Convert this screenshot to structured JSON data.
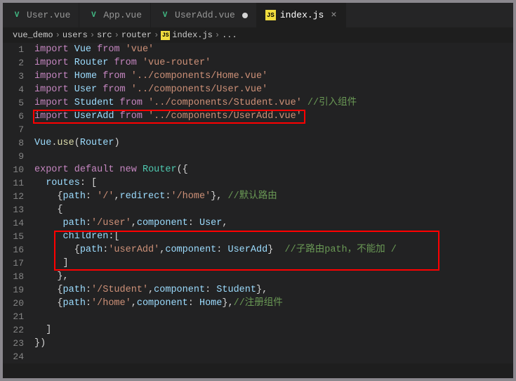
{
  "tabs": [
    {
      "icon": "V",
      "label": "User.vue",
      "modified": false,
      "close": false
    },
    {
      "icon": "V",
      "label": "App.vue",
      "modified": false,
      "close": false
    },
    {
      "icon": "V",
      "label": "UserAdd.vue",
      "modified": true,
      "close": false
    },
    {
      "icon": "JS",
      "label": "index.js",
      "modified": false,
      "close": true,
      "active": true
    }
  ],
  "breadcrumb": [
    "vue_demo",
    "users",
    "src",
    "router",
    "index.js",
    "..."
  ],
  "code": {
    "l1_a": "import",
    "l1_b": "Vue",
    "l1_c": "from",
    "l1_d": "'vue'",
    "l2_a": "import",
    "l2_b": "Router",
    "l2_c": "from",
    "l2_d": "'vue-router'",
    "l3_a": "import",
    "l3_b": "Home",
    "l3_c": "from",
    "l3_d": "'../components/Home.vue'",
    "l4_a": "import",
    "l4_b": "User",
    "l4_c": "from",
    "l4_d": "'../components/User.vue'",
    "l5_a": "import",
    "l5_b": "Student",
    "l5_c": "from",
    "l5_d": "'../components/Student.vue'",
    "l5_e": " //引入组件",
    "l6_a": "import",
    "l6_b": "UserAdd",
    "l6_c": "from",
    "l6_d": "'../components/UserAdd.vue'",
    "l8_a": "Vue",
    "l8_b": ".",
    "l8_c": "use",
    "l8_d": "(",
    "l8_e": "Router",
    "l8_f": ")",
    "l10_a": "export",
    "l10_b": "default",
    "l10_c": "new",
    "l10_d": "Router",
    "l10_e": "({",
    "l11_a": "  ",
    "l11_b": "routes",
    "l11_c": ": [",
    "l12_a": "    {",
    "l12_b": "path",
    "l12_c": ": ",
    "l12_d": "'/'",
    "l12_e": ",",
    "l12_f": "redirect",
    "l12_g": ":",
    "l12_h": "'/home'",
    "l12_i": "}, ",
    "l12_j": "//默认路由",
    "l13_a": "    {",
    "l14_a": "     ",
    "l14_b": "path",
    "l14_c": ":",
    "l14_d": "'/user'",
    "l14_e": ",",
    "l14_f": "component",
    "l14_g": ": ",
    "l14_h": "User",
    "l14_i": ",",
    "l15_a": "     ",
    "l15_b": "children",
    "l15_c": ":[",
    "l16_a": "       {",
    "l16_b": "path",
    "l16_c": ":",
    "l16_d": "'userAdd'",
    "l16_e": ",",
    "l16_f": "component",
    "l16_g": ": ",
    "l16_h": "UserAdd",
    "l16_i": "}",
    "l16_j": "  //子路由path，不能加 /",
    "l17_a": "     ]",
    "l18_a": "    },",
    "l19_a": "    {",
    "l19_b": "path",
    "l19_c": ":",
    "l19_d": "'/Student'",
    "l19_e": ",",
    "l19_f": "component",
    "l19_g": ": ",
    "l19_h": "Student",
    "l19_i": "},",
    "l20_a": "    {",
    "l20_b": "path",
    "l20_c": ":",
    "l20_d": "'/home'",
    "l20_e": ",",
    "l20_f": "component",
    "l20_g": ": ",
    "l20_h": "Home",
    "l20_i": "},",
    "l20_j": "//注册组件",
    "l22_a": "  ]",
    "l23_a": "})"
  },
  "line_numbers": [
    "1",
    "2",
    "3",
    "4",
    "5",
    "6",
    "7",
    "8",
    "9",
    "10",
    "11",
    "12",
    "13",
    "14",
    "15",
    "16",
    "17",
    "18",
    "19",
    "20",
    "21",
    "22",
    "23",
    "24"
  ]
}
